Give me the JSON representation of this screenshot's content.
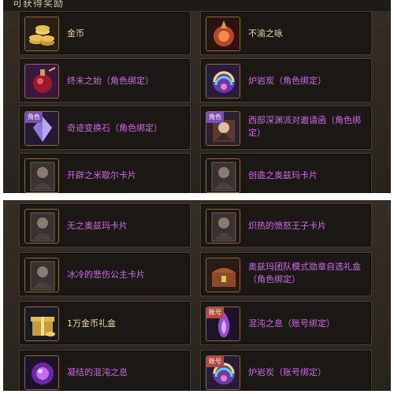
{
  "header": {
    "title": "可获得奖励"
  },
  "top_rewards": [
    {
      "label": "金币",
      "icon": "gold-coins-icon",
      "color": "gold",
      "badge": ""
    },
    {
      "label": "不渝之咏",
      "icon": "red-orb-icon",
      "color": "gold",
      "badge": ""
    },
    {
      "label": "终末之始（角色绑定）",
      "icon": "red-potion-icon",
      "color": "purple",
      "badge": ""
    },
    {
      "label": "炉岩炭（角色绑定）",
      "icon": "rainbow-stone-icon",
      "color": "purple",
      "badge": ""
    },
    {
      "label": "奇迹变换石（角色绑定）",
      "icon": "crystal-icon",
      "color": "purple",
      "badge": "角色"
    },
    {
      "label": "西部深渊派对邀请函（角色绑定）",
      "icon": "invitation-icon",
      "color": "purple",
      "badge": "角色"
    },
    {
      "label": "开辟之米歇尔卡片",
      "icon": "card-portrait-icon",
      "color": "purple",
      "badge": ""
    },
    {
      "label": "创造之奥兹玛卡片",
      "icon": "card-portrait-icon",
      "color": "purple",
      "badge": ""
    }
  ],
  "bottom_rewards": [
    {
      "label": "无之奥兹玛卡片",
      "icon": "card-portrait-icon",
      "color": "purple",
      "badge": ""
    },
    {
      "label": "炽热的愤怒王子卡片",
      "icon": "card-portrait-icon",
      "color": "purple",
      "badge": ""
    },
    {
      "label": "冰冷的悲伤公主卡片",
      "icon": "card-portrait-icon",
      "color": "purple",
      "badge": ""
    },
    {
      "label": "奥兹玛团队模式勋章自选礼盒（角色绑定）",
      "icon": "treasure-chest-icon",
      "color": "purple",
      "badge": ""
    },
    {
      "label": "1万金币礼盒",
      "icon": "gold-box-icon",
      "color": "gold",
      "badge": ""
    },
    {
      "label": "混沌之息（账号绑定）",
      "icon": "purple-flame-icon",
      "color": "purple",
      "badge": "账号"
    },
    {
      "label": "凝结的混沌之息",
      "icon": "purple-orb-icon",
      "color": "purple",
      "badge": ""
    },
    {
      "label": "炉岩炭（账号绑定）",
      "icon": "rainbow-stone-icon",
      "color": "purple",
      "badge": "账号"
    }
  ],
  "colors": {
    "purple": "#c86ae0",
    "gold": "#e8d7a8",
    "frame": "#8a6a3a",
    "panel": "#2d2721"
  }
}
